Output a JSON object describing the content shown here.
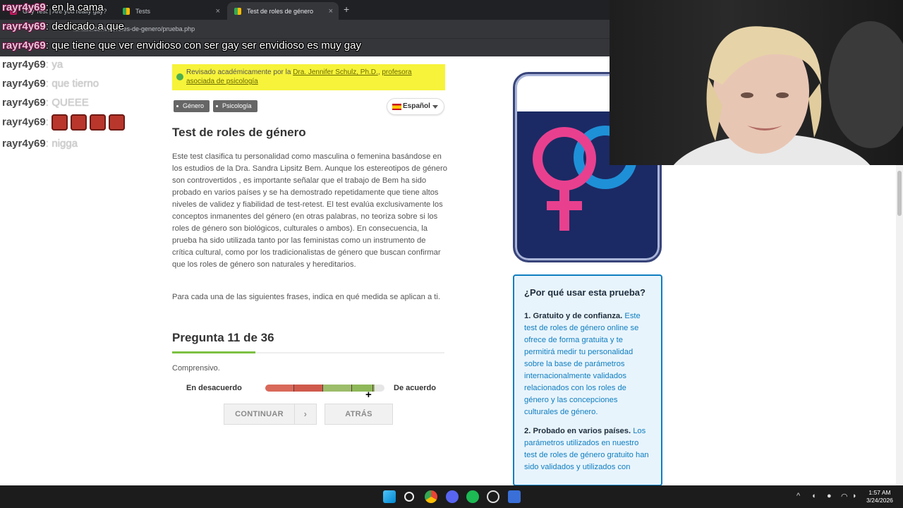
{
  "browser": {
    "tabs": [
      {
        "label": "Gay Test | Are you really gay?",
        "active": false
      },
      {
        "label": "Tests",
        "active": false
      },
      {
        "label": "Test de roles de género",
        "active": true
      }
    ],
    "url": "idrlabs.com/es/roles-de-genero/prueba.php",
    "new_tab": "+",
    "close": "×"
  },
  "chat": {
    "lines": [
      {
        "user": "rayr4y69",
        "msg": "en la cama"
      },
      {
        "user": "rayr4y69",
        "msg": "dedicado a que"
      },
      {
        "user": "rayr4y69",
        "msg": "que tiene que ver envidioso con ser gay ser envidioso es muy gay"
      },
      {
        "user": "rayr4y69",
        "msg": "ya"
      },
      {
        "user": "rayr4y69",
        "msg": "que tierno"
      },
      {
        "user": "rayr4y69",
        "msg": "QUEEE"
      },
      {
        "user": "rayr4y69",
        "msg": ""
      },
      {
        "user": "rayr4y69",
        "msg": "nigga"
      }
    ],
    "colon": ":"
  },
  "page": {
    "review_prefix": "Revisado académicamente por la ",
    "review_author": "Dra. Jennifer Schulz, Ph.D.",
    "review_sep": ", ",
    "review_role": "profesora asociada de psicología",
    "tags": [
      "Género",
      "Psicología"
    ],
    "language": "Español",
    "title": "Test de roles de género",
    "description": "Este test clasifica tu personalidad como masculina o femenina basándose en los estudios de la Dra. Sandra Lipsitz Bem. Aunque los estereotipos de género son controvertidos , es importante señalar que el trabajo de Bem ha sido probado en varios países y se ha demostrado repetidamente que tiene altos niveles de validez y fiabilidad de test-retest. El test evalúa exclusivamente los conceptos inmanentes del género (en otras palabras, no teoriza sobre si los roles de género son biológicos, culturales o ambos). En consecuencia, la prueba ha sido utilizada tanto por las feministas como un instrumento de crítica cultural, como por los tradicionalistas de género que buscan confirmar que los roles de género son naturales y hereditarios.",
    "instruction": "Para cada una de las siguientes frases, indica en qué medida se aplican a ti.",
    "question_title": "Pregunta 11 de 36",
    "question_progress": 0.3056,
    "question_text": "Comprensivo.",
    "scale_left": "En desacuerdo",
    "scale_right": "De acuerdo",
    "scale_value_fraction": 0.92,
    "continue_label": "CONTINUAR",
    "continue_arrow": "›",
    "back_label": "ATRÁS"
  },
  "sidebar": {
    "why_title": "¿Por qué usar esta prueba?",
    "points": [
      {
        "head": "1. Gratuito y de confianza.",
        "body": " Este test de roles de género online se ofrece de forma gratuita y te permitirá medir tu personalidad sobre la base de parámetros internacionalmente validados relacionados con los roles de género y las concepciones culturales de género."
      },
      {
        "head": "2. Probado en varios países.",
        "body": " Los parámetros utilizados en nuestro test de roles de género gratuito han sido validados y utilizados con"
      }
    ]
  },
  "taskbar": {
    "time": "1:57 AM",
    "date": "3/24/2026"
  },
  "colors": {
    "accent_green": "#7cc142",
    "review_yellow": "#f6f33a",
    "sidebar_blue": "#0f7ec0",
    "scale_red": "#d9695a",
    "scale_green": "#9cbd6a"
  }
}
